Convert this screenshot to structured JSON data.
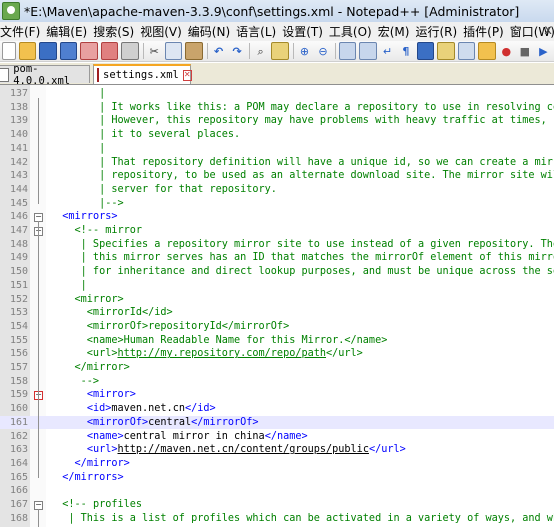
{
  "window": {
    "title": "*E:\\Maven\\apache-maven-3.3.9\\conf\\settings.xml - Notepad++ [Administrator]"
  },
  "menu": [
    "文件(F)",
    "编辑(E)",
    "搜索(S)",
    "视图(V)",
    "编码(N)",
    "语言(L)",
    "设置(T)",
    "工具(O)",
    "宏(M)",
    "运行(R)",
    "插件(P)",
    "窗口(W)"
  ],
  "menu_close": "x",
  "tabs": [
    {
      "label": "pom-4.0.0.xml",
      "active": false
    },
    {
      "label": "settings.xml",
      "active": true
    }
  ],
  "editor": {
    "lines": [
      {
        "n": "137",
        "segs": [
          {
            "t": "        |",
            "c": "cmt"
          }
        ]
      },
      {
        "n": "138",
        "segs": [
          {
            "t": "        | It works like this: a POM may declare a repository to use in resolving certain",
            "c": "cmt"
          }
        ]
      },
      {
        "n": "139",
        "segs": [
          {
            "t": "        | However, this repository may have problems with heavy traffic at times, so peop",
            "c": "cmt"
          }
        ]
      },
      {
        "n": "140",
        "segs": [
          {
            "t": "        | it to several places.",
            "c": "cmt"
          }
        ]
      },
      {
        "n": "141",
        "segs": [
          {
            "t": "        |",
            "c": "cmt"
          }
        ]
      },
      {
        "n": "142",
        "segs": [
          {
            "t": "        | That repository definition will have a unique id, so we can create a mirror ref",
            "c": "cmt"
          }
        ]
      },
      {
        "n": "143",
        "segs": [
          {
            "t": "        | repository, to be used as an alternate download site. The mirror site will be t",
            "c": "cmt"
          }
        ]
      },
      {
        "n": "144",
        "segs": [
          {
            "t": "        | server for that repository.",
            "c": "cmt"
          }
        ]
      },
      {
        "n": "145",
        "segs": [
          {
            "t": "        |-->",
            "c": "cmt"
          }
        ]
      },
      {
        "n": "146",
        "segs": [
          {
            "t": "  ",
            "c": "txt"
          },
          {
            "t": "<mirrors>",
            "c": "tag"
          }
        ]
      },
      {
        "n": "147",
        "segs": [
          {
            "t": "    ",
            "c": "txt"
          },
          {
            "t": "<!-- mirror",
            "c": "cmt"
          }
        ]
      },
      {
        "n": "148",
        "segs": [
          {
            "t": "     | Specifies a repository mirror site to use instead of a given repository. The",
            "c": "cmt"
          }
        ]
      },
      {
        "n": "149",
        "segs": [
          {
            "t": "     | this mirror serves has an ID that matches the mirrorOf element of this mirror",
            "c": "cmt"
          }
        ]
      },
      {
        "n": "150",
        "segs": [
          {
            "t": "     | for inheritance and direct lookup purposes, and must be unique across the set",
            "c": "cmt"
          }
        ]
      },
      {
        "n": "151",
        "segs": [
          {
            "t": "     |",
            "c": "cmt"
          }
        ]
      },
      {
        "n": "152",
        "segs": [
          {
            "t": "    <mirror>",
            "c": "cmt"
          }
        ]
      },
      {
        "n": "153",
        "segs": [
          {
            "t": "      <mirrorId</id>",
            "c": "cmt"
          }
        ]
      },
      {
        "n": "154",
        "segs": [
          {
            "t": "      <mirrorOf>repositoryId</mirrorOf>",
            "c": "cmt"
          }
        ]
      },
      {
        "n": "155",
        "segs": [
          {
            "t": "      <name>Human Readable Name for this Mirror.</name>",
            "c": "cmt"
          }
        ]
      },
      {
        "n": "156",
        "segs": [
          {
            "t": "      <url>",
            "c": "cmt"
          },
          {
            "t": "http://my.repository.com/repo/path",
            "c": "cmt",
            "u": true
          },
          {
            "t": "</url>",
            "c": "cmt"
          }
        ]
      },
      {
        "n": "157",
        "segs": [
          {
            "t": "    </mirror>",
            "c": "cmt"
          }
        ]
      },
      {
        "n": "158",
        "segs": [
          {
            "t": "     -->",
            "c": "cmt"
          }
        ]
      },
      {
        "n": "159",
        "segs": [
          {
            "t": "      ",
            "c": "txt"
          },
          {
            "t": "<mirror>",
            "c": "tag"
          }
        ]
      },
      {
        "n": "160",
        "segs": [
          {
            "t": "      ",
            "c": "txt"
          },
          {
            "t": "<id>",
            "c": "tag"
          },
          {
            "t": "maven.net.cn",
            "c": "txt"
          },
          {
            "t": "</id>",
            "c": "tag"
          }
        ]
      },
      {
        "n": "161",
        "segs": [
          {
            "t": "      ",
            "c": "txt"
          },
          {
            "t": "<mirrorOf>",
            "c": "tag"
          },
          {
            "t": "central",
            "c": "txt"
          },
          {
            "t": "</mirrorOf>",
            "c": "tag"
          }
        ]
      },
      {
        "n": "162",
        "segs": [
          {
            "t": "      ",
            "c": "txt"
          },
          {
            "t": "<name>",
            "c": "tag"
          },
          {
            "t": "central mirror in china",
            "c": "txt"
          },
          {
            "t": "</name>",
            "c": "tag"
          }
        ]
      },
      {
        "n": "163",
        "segs": [
          {
            "t": "      ",
            "c": "txt"
          },
          {
            "t": "<url>",
            "c": "tag"
          },
          {
            "t": "http://maven.net.cn/content/groups/public",
            "c": "url"
          },
          {
            "t": "</url>",
            "c": "tag"
          }
        ]
      },
      {
        "n": "164",
        "segs": [
          {
            "t": "    ",
            "c": "txt"
          },
          {
            "t": "</mirror>",
            "c": "tag"
          }
        ]
      },
      {
        "n": "165",
        "segs": [
          {
            "t": "  ",
            "c": "txt"
          },
          {
            "t": "</mirrors>",
            "c": "tag"
          }
        ]
      },
      {
        "n": "166",
        "segs": [
          {
            "t": "",
            "c": "txt"
          }
        ]
      },
      {
        "n": "167",
        "segs": [
          {
            "t": "  ",
            "c": "txt"
          },
          {
            "t": "<!-- profiles",
            "c": "cmt"
          }
        ]
      },
      {
        "n": "168",
        "segs": [
          {
            "t": "   | This is a list of profiles which can be activated in a variety of ways, and whi",
            "c": "cmt"
          }
        ]
      }
    ],
    "current_line": "161"
  }
}
